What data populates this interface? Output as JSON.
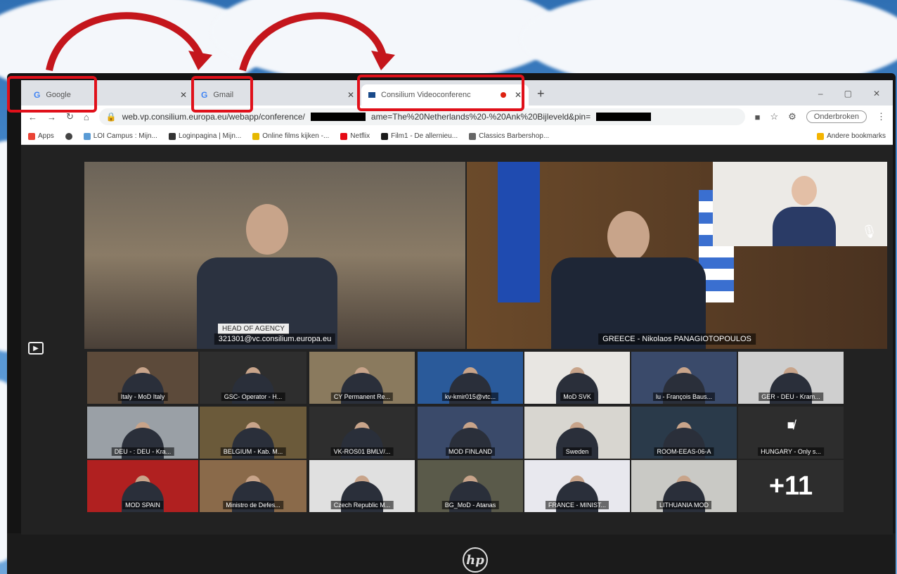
{
  "browser": {
    "tabs": [
      {
        "title": "Google",
        "icon": "google-g-icon"
      },
      {
        "title": "Gmail",
        "icon": "google-g-icon"
      },
      {
        "title": "Consilium Videoconferenc",
        "icon": "consilium-icon"
      }
    ],
    "new_tab": "+",
    "window_controls": [
      "–",
      "▢",
      "✕"
    ],
    "url": "web.vp.consilium.europa.eu/webapp/conference/",
    "url_tail": "ame=The%20Netherlands%20-%20Ank%20Bijleveld&pin=",
    "profile_pill": "Onderbroken",
    "bookmarks": [
      {
        "label": "Apps",
        "color": "#ea4335"
      },
      {
        "label": "",
        "color": "#444"
      },
      {
        "label": "LOI Campus : Mijn...",
        "color": "#5a9bd5"
      },
      {
        "label": "Loginpagina | Mijn...",
        "color": "#333"
      },
      {
        "label": "Online films kijken -...",
        "color": "#e6b800"
      },
      {
        "label": "Netflix",
        "color": "#e50914"
      },
      {
        "label": "Film1 - De allernieu...",
        "color": "#1a1a1a"
      },
      {
        "label": "Classics Barbershop...",
        "color": "#666"
      }
    ],
    "other_bookmarks": "Andere bookmarks"
  },
  "conference": {
    "main": [
      {
        "label": "321301@vc.consilium.europa.eu"
      },
      {
        "label": "GREECE - Nikolaos PANAGIOTOPOULOS"
      }
    ],
    "head_of_agency_sign": "HEAD OF AGENCY",
    "tiles": [
      "Italy - MoD Italy",
      "GSC- Operator - H...",
      "CY Permanent Re...",
      "kv-kmir015@vtc...",
      "MoD SVK",
      "lu - François Baus...",
      "GER - DEU - Kram...",
      "DEU - : DEU - Kra...",
      "BELGIUM - Kab. M...",
      "VK-ROS01 BMLV/...",
      "MOD FINLAND",
      "Sweden",
      "ROOM-EEAS-06-A",
      "MOD SPAIN",
      "Ministro de Defes...",
      "Czech Republic M...",
      "BG_MoD - Atanas",
      "FRANCE - MINIST...",
      "LITHUANIA MOD"
    ],
    "camera_off_tile": "HUNGARY - Only s...",
    "more_count": "+11"
  },
  "laptop_brand": "hp"
}
